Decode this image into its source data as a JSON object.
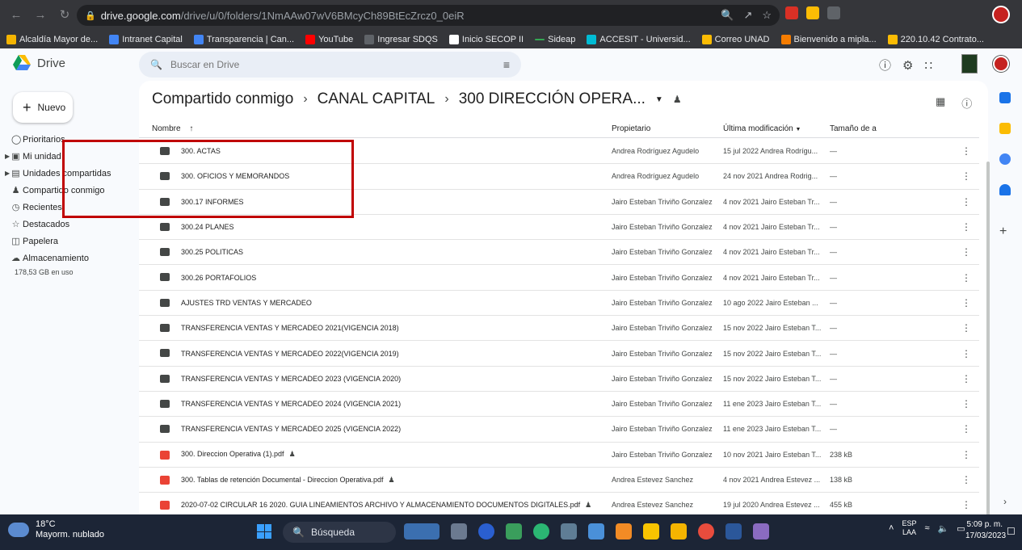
{
  "browser": {
    "url_host": "drive.google.com",
    "url_path": "/drive/u/0/folders/1NmAAw07wV6BMcyCh89BtEcZrcz0_0eiR",
    "bookmarks": [
      {
        "label": "Alcaldía Mayor de...",
        "color": "#f4b400"
      },
      {
        "label": "Intranet Capital",
        "color": "#4285f4"
      },
      {
        "label": "Transparencia | Can...",
        "color": "#4285f4"
      },
      {
        "label": "YouTube",
        "color": "#ff0000"
      },
      {
        "label": "Ingresar SDQS",
        "color": "#5f6368"
      },
      {
        "label": "Inicio SECOP II",
        "color": "#ffffff"
      },
      {
        "label": "Sideap",
        "color": "#34a853"
      },
      {
        "label": "ACCESIT - Universid...",
        "color": "#00bcd4"
      },
      {
        "label": "Correo UNAD",
        "color": "#fbbc04"
      },
      {
        "label": "Bienvenido a mipla...",
        "color": "#f57c00"
      },
      {
        "label": "220.10.42 Contrato...",
        "color": "#fbbc04"
      }
    ]
  },
  "drive": {
    "logo_label": "Drive",
    "search_placeholder": "Buscar en Drive",
    "new_button": "Nuevo",
    "nav": [
      {
        "label": "Prioritarios",
        "icon": "check-circle-icon",
        "caret": false
      },
      {
        "label": "Mi unidad",
        "icon": "drive-icon",
        "caret": true
      },
      {
        "label": "Unidades compartidas",
        "icon": "shared-drive-icon",
        "caret": true
      },
      {
        "label": "Compartido conmigo",
        "icon": "people-icon",
        "caret": false
      },
      {
        "label": "Recientes",
        "icon": "clock-icon",
        "caret": false
      },
      {
        "label": "Destacados",
        "icon": "star-icon",
        "caret": false
      },
      {
        "label": "Papelera",
        "icon": "trash-icon",
        "caret": false
      },
      {
        "label": "Almacenamiento",
        "icon": "cloud-icon",
        "caret": false
      }
    ],
    "storage_used": "178,53 GB en uso",
    "breadcrumb": [
      "Compartido conmigo",
      "CANAL CAPITAL",
      "300 DIRECCIÓN OPERA..."
    ],
    "columns": {
      "name": "Nombre",
      "owner": "Propietario",
      "modified": "Última modificación",
      "size": "Tamaño de a"
    },
    "rows": [
      {
        "type": "folder",
        "name": "300. ACTAS",
        "shared": false,
        "owner": "Andrea Rodríguez Agudelo",
        "modified": "15 jul 2022 Andrea Rodrígu...",
        "size": "—"
      },
      {
        "type": "folder",
        "name": "300. OFICIOS Y MEMORANDOS",
        "shared": false,
        "owner": "Andrea Rodríguez Agudelo",
        "modified": "24 nov 2021 Andrea Rodrig...",
        "size": "—"
      },
      {
        "type": "folder",
        "name": "300.17 INFORMES",
        "shared": false,
        "owner": "Jairo Esteban Triviño Gonzalez",
        "modified": "4 nov 2021 Jairo Esteban Tr...",
        "size": "—"
      },
      {
        "type": "folder",
        "name": "300.24 PLANES",
        "shared": false,
        "owner": "Jairo Esteban Triviño Gonzalez",
        "modified": "4 nov 2021 Jairo Esteban Tr...",
        "size": "—"
      },
      {
        "type": "folder",
        "name": "300.25 POLITICAS",
        "shared": false,
        "owner": "Jairo Esteban Triviño Gonzalez",
        "modified": "4 nov 2021 Jairo Esteban Tr...",
        "size": "—"
      },
      {
        "type": "folder",
        "name": "300.26 PORTAFOLIOS",
        "shared": false,
        "owner": "Jairo Esteban Triviño Gonzalez",
        "modified": "4 nov 2021 Jairo Esteban Tr...",
        "size": "—"
      },
      {
        "type": "folder",
        "name": "AJUSTES TRD VENTAS Y MERCADEO",
        "shared": false,
        "owner": "Jairo Esteban Triviño Gonzalez",
        "modified": "10 ago 2022 Jairo Esteban ...",
        "size": "—"
      },
      {
        "type": "folder",
        "name": "TRANSFERENCIA VENTAS Y MERCADEO 2021(VIGENCIA 2018)",
        "shared": false,
        "owner": "Jairo Esteban Triviño Gonzalez",
        "modified": "15 nov 2022 Jairo Esteban T...",
        "size": "—"
      },
      {
        "type": "folder",
        "name": "TRANSFERENCIA VENTAS Y MERCADEO 2022(VIGENCIA 2019)",
        "shared": false,
        "owner": "Jairo Esteban Triviño Gonzalez",
        "modified": "15 nov 2022 Jairo Esteban T...",
        "size": "—"
      },
      {
        "type": "folder",
        "name": "TRANSFERENCIA VENTAS Y MERCADEO 2023 (VIGENCIA 2020)",
        "shared": false,
        "owner": "Jairo Esteban Triviño Gonzalez",
        "modified": "15 nov 2022 Jairo Esteban T...",
        "size": "—"
      },
      {
        "type": "folder",
        "name": "TRANSFERENCIA VENTAS Y MERCADEO 2024 (VIGENCIA 2021)",
        "shared": false,
        "owner": "Jairo Esteban Triviño Gonzalez",
        "modified": "11 ene 2023 Jairo Esteban T...",
        "size": "—"
      },
      {
        "type": "folder",
        "name": "TRANSFERENCIA VENTAS Y MERCADEO 2025 (VIGENCIA 2022)",
        "shared": false,
        "owner": "Jairo Esteban Triviño Gonzalez",
        "modified": "11 ene 2023 Jairo Esteban T...",
        "size": "—"
      },
      {
        "type": "pdf",
        "name": "300. Direccion Operativa (1).pdf",
        "shared": true,
        "owner": "Jairo Esteban Triviño Gonzalez",
        "modified": "10 nov 2021 Jairo Esteban T...",
        "size": "238 kB"
      },
      {
        "type": "pdf",
        "name": "300. Tablas de retención Documental - Direccion Operativa.pdf",
        "shared": true,
        "owner": "Andrea Estevez Sanchez",
        "modified": "4 nov 2021 Andrea Estevez ...",
        "size": "138 kB"
      },
      {
        "type": "pdf",
        "name": "2020-07-02 CIRCULAR 16 2020. GUIA LINEAMIENTOS ARCHIVO Y ALMACENAMIENTO DOCUMENTOS DIGITALES.pdf",
        "shared": true,
        "owner": "Andrea Estevez Sanchez",
        "modified": "19 jul 2020 Andrea Estevez ...",
        "size": "455 kB"
      }
    ]
  },
  "taskbar": {
    "temperature": "18°C",
    "weather": "Mayorm. nublado",
    "search": "Búsqueda",
    "lang_top": "ESP",
    "lang_bottom": "LAA",
    "time": "5:09 p. m.",
    "date": "17/03/2023"
  }
}
